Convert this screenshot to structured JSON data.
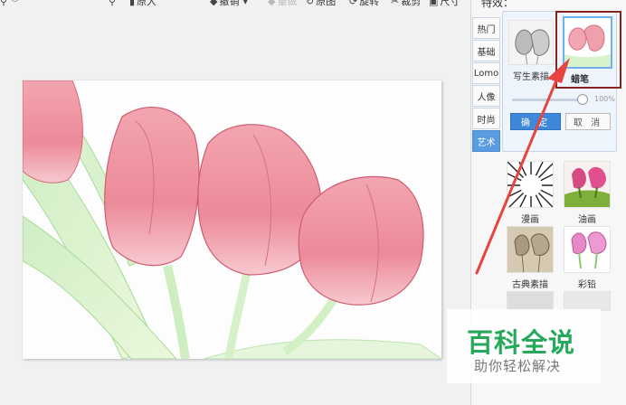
{
  "toolbar": {
    "original_size": "原大",
    "undo": "撤销",
    "redo": "重做",
    "reset": "原图",
    "rotate": "旋转",
    "crop": "裁剪",
    "size": "尺寸"
  },
  "panel": {
    "title": "特效：",
    "tabs": [
      "热门",
      "基础",
      "Lomo",
      "人像",
      "时尚",
      "艺术"
    ],
    "active_tab": "艺术",
    "effects": {
      "sketch": "写生素描",
      "crayon": "蜡笔",
      "comic": "漫画",
      "oil": "油画",
      "classic_sketch": "古典素描",
      "color_pencil": "彩铅"
    },
    "intensity_label": "100%",
    "intensity_level": 1.0,
    "ok": "确 定",
    "cancel": "取 消"
  },
  "watermark": {
    "title": "百科全说",
    "subtitle": "助你轻松解决"
  },
  "colors": {
    "accent_blue": "#3f87d8",
    "selection_border": "#8a2222",
    "arrow_red": "#e8443f",
    "watermark_green": "#27a85a"
  }
}
